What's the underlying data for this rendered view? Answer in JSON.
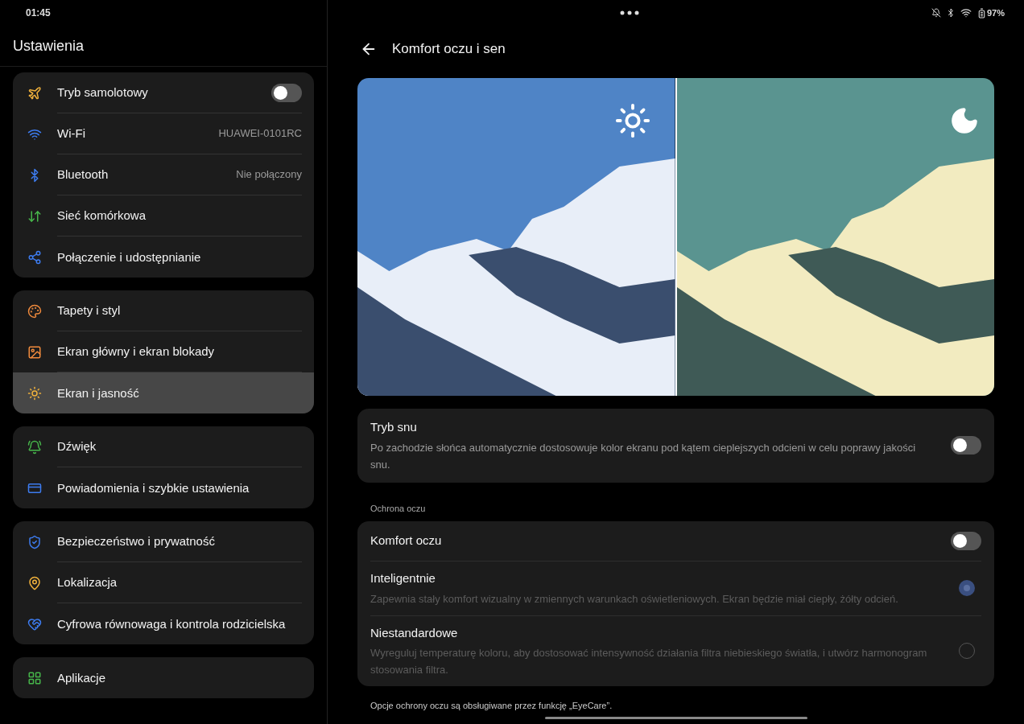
{
  "status_bar": {
    "time": "01:45",
    "battery": "97%"
  },
  "sidebar": {
    "title": "Ustawienia",
    "groups": [
      {
        "items": [
          {
            "label": "Tryb samolotowy",
            "kind": "toggle",
            "on": false,
            "selected": false
          },
          {
            "label": "Wi-Fi",
            "kind": "value",
            "value": "HUAWEI-0101RC",
            "selected": false
          },
          {
            "label": "Bluetooth",
            "kind": "value",
            "value": "Nie połączony",
            "selected": false
          },
          {
            "label": "Sieć komórkowa",
            "kind": "link",
            "selected": false
          },
          {
            "label": "Połączenie i udostępnianie",
            "kind": "link",
            "selected": false
          }
        ]
      },
      {
        "items": [
          {
            "label": "Tapety i styl",
            "kind": "link",
            "selected": false
          },
          {
            "label": "Ekran główny i ekran blokady",
            "kind": "link",
            "selected": false
          },
          {
            "label": "Ekran i jasność",
            "kind": "link",
            "selected": true
          }
        ]
      },
      {
        "items": [
          {
            "label": "Dźwięk",
            "kind": "link",
            "selected": false
          },
          {
            "label": "Powiadomienia i szybkie ustawienia",
            "kind": "link",
            "selected": false
          }
        ]
      },
      {
        "items": [
          {
            "label": "Bezpieczeństwo i prywatność",
            "kind": "link",
            "selected": false
          },
          {
            "label": "Lokalizacja",
            "kind": "link",
            "selected": false
          },
          {
            "label": "Cyfrowa równowaga i kontrola rodzicielska",
            "kind": "link",
            "selected": false
          }
        ]
      },
      {
        "items": [
          {
            "label": "Aplikacje",
            "kind": "link",
            "selected": false
          }
        ]
      }
    ]
  },
  "page": {
    "title": "Komfort oczu i sen",
    "sleep_mode": {
      "title": "Tryb snu",
      "description": "Po zachodzie słońca automatycznie dostosowuje kolor ekranu pod kątem cieplejszych odcieni w celu poprawy jakości snu.",
      "on": false
    },
    "section_label": "Ochrona oczu",
    "eye_comfort": {
      "title": "Komfort oczu",
      "on": false,
      "options": [
        {
          "title": "Inteligentnie",
          "description": "Zapewnia stały komfort wizualny w zmiennych warunkach oświetleniowych. Ekran będzie miał ciepły, żółty odcień.",
          "selected": true,
          "disabled": true
        },
        {
          "title": "Niestandardowe",
          "description": "Wyreguluj temperaturę koloru, aby dostosować intensywność działania filtra niebieskiego światła, i utwórz harmonogram stosowania filtra.",
          "selected": false,
          "disabled": true
        }
      ]
    },
    "footnote": "Opcje ochrony oczu są obsługiwane przez funkcję „EyeCare”."
  }
}
